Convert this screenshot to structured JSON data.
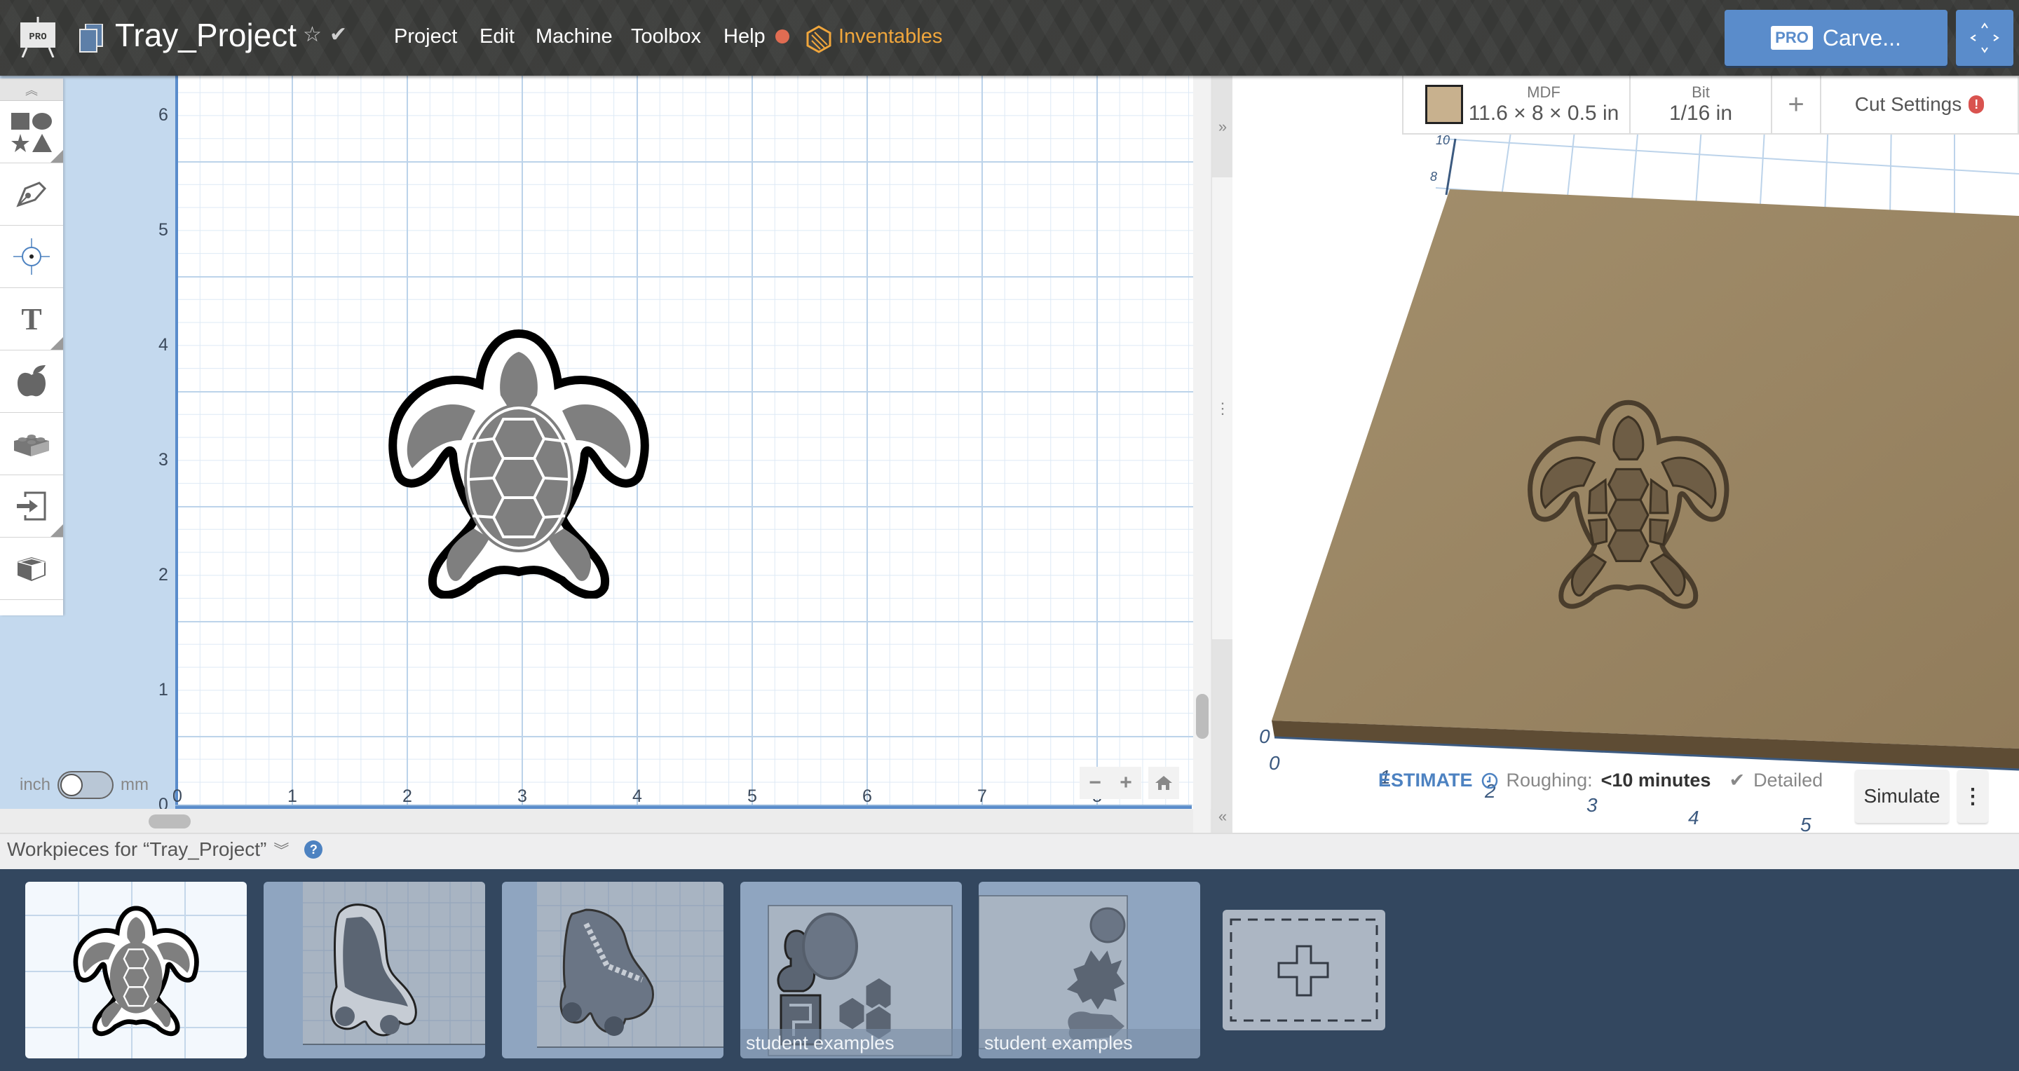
{
  "header": {
    "logo_badge": "PRO",
    "project_title": "Tray_Project",
    "menus": [
      "Project",
      "Edit",
      "Machine",
      "Toolbox",
      "Help"
    ],
    "inventables_label": "Inventables",
    "carve_badge": "PRO",
    "carve_label": "Carve...",
    "colors": {
      "accent": "#5a8ccb",
      "inventables": "#f0a63c",
      "notification": "#e06c52"
    }
  },
  "toolbar": {
    "items": [
      {
        "name": "shapes",
        "icon": "shapes-icon"
      },
      {
        "name": "pen",
        "icon": "pen-tool-icon"
      },
      {
        "name": "point",
        "icon": "crosshair-icon"
      },
      {
        "name": "text",
        "icon": "text-icon"
      },
      {
        "name": "icon-library",
        "icon": "apple-icon"
      },
      {
        "name": "apps",
        "icon": "lego-brick-icon"
      },
      {
        "name": "import",
        "icon": "import-icon"
      },
      {
        "name": "3d-models",
        "icon": "cube-icon"
      }
    ]
  },
  "canvas": {
    "y_ticks": [
      "6",
      "5",
      "4",
      "3",
      "2",
      "1",
      "0"
    ],
    "x_ticks": [
      "0",
      "1",
      "2",
      "3",
      "4",
      "5",
      "6",
      "7",
      "8"
    ],
    "unit_left": "inch",
    "unit_right": "mm",
    "unit_selected": "inch",
    "zoom_out": "−",
    "zoom_in": "+"
  },
  "material": {
    "material_label": "MDF",
    "dimensions": "11.6 × 8 × 0.5 in",
    "swatch_color": "#c8b18e",
    "bit_label": "Bit",
    "bit_value": "1/16 in",
    "add_label": "+",
    "cut_settings_label": "Cut Settings",
    "cut_settings_warning": "!"
  },
  "view3d": {
    "x_ticks": [
      "0",
      "1",
      "2",
      "3",
      "4",
      "5"
    ],
    "y_ticks": [
      "0",
      "8",
      "10"
    ]
  },
  "estimate": {
    "label": "ESTIMATE",
    "roughing_label": "Roughing:",
    "roughing_value": "<10 minutes",
    "detailed_label": "Detailed",
    "simulate_label": "Simulate",
    "more_label": "⋮"
  },
  "workpieces": {
    "title": "Workpieces for “Tray_Project”",
    "help": "?",
    "items": [
      {
        "name": "sea-turtle",
        "caption": "",
        "active": true
      },
      {
        "name": "roller-skate",
        "caption": "",
        "active": false
      },
      {
        "name": "roller-skates-pair",
        "caption": "",
        "active": false
      },
      {
        "name": "student-examples-1",
        "caption": "student examples",
        "active": false
      },
      {
        "name": "student-examples-2",
        "caption": "student examples",
        "active": false
      }
    ]
  }
}
